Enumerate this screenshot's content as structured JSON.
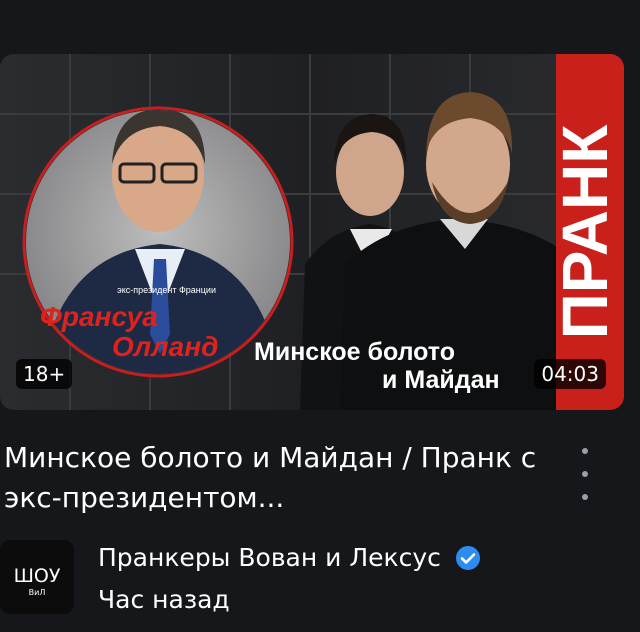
{
  "video": {
    "age_rating": "18+",
    "duration": "04:03",
    "thumbnail": {
      "circle_subtitle": "экс-президент Франции",
      "name_line1": "Франсуа",
      "name_line2": "Олланд",
      "overlay_line1": "Минское болото",
      "overlay_line2": "и Майдан",
      "side_text": "ПРАНК",
      "accent_color": "#e0221c"
    },
    "title": "Минское болото и Майдан / Пранк с экс-президентом...",
    "more_icon": "vertical-ellipsis-icon"
  },
  "channel": {
    "avatar_text": "ШОУ",
    "avatar_subtext": "ВиЛ",
    "name": "Пранкеры Вован и Лексус",
    "verified_icon": "verified-check-icon",
    "verified_color": "#2d8cf0",
    "published": "Час назад"
  }
}
